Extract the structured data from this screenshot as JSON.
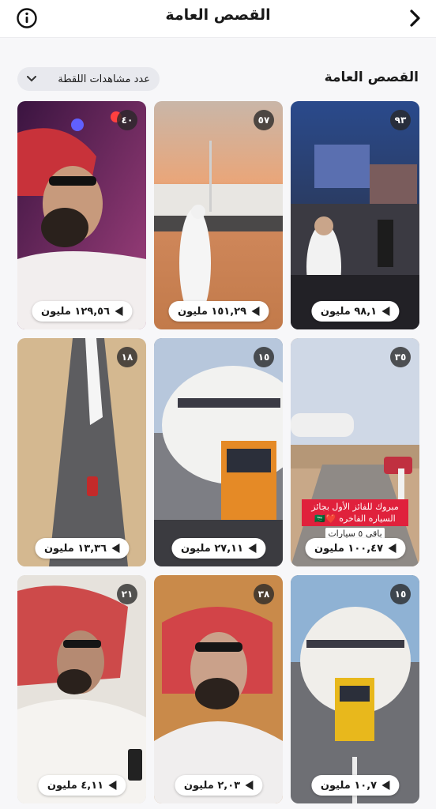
{
  "header": {
    "title": "القصص العامة"
  },
  "section": {
    "title": "القصص العامة",
    "sort_label": "عدد مشاهدات اللقطة"
  },
  "stories": [
    {
      "badge": "٩٣",
      "views": "٩٨,١ مليون",
      "scene": "arena"
    },
    {
      "badge": "٥٧",
      "views": "١٥١,٢٩ مليون",
      "scene": "desert-plane"
    },
    {
      "badge": "٤٠",
      "views": "١٢٩,٥٦ مليون",
      "scene": "portrait-smile"
    },
    {
      "badge": "٣٥",
      "views": "١٠٠,٤٧ مليون",
      "scene": "car-road",
      "overlay": "مبروك للفائز الأول بجائز السياره الفاخره ❤️🇸🇦",
      "overlay_sub": "باقي ٥ سيارات"
    },
    {
      "badge": "١٥",
      "views": "٢٧,١١ مليون",
      "scene": "plane-truck"
    },
    {
      "badge": "١٨",
      "views": "١٣,٣٦ مليون",
      "scene": "aerial-road"
    },
    {
      "badge": "١٥",
      "views": "١٠,٧ مليون",
      "scene": "plane-truck-road"
    },
    {
      "badge": "٣٨",
      "views": "٢,٠٣ مليون",
      "scene": "portrait-glasses"
    },
    {
      "badge": "٢١",
      "views": "٤,١١ مليون",
      "scene": "portrait-phone"
    }
  ],
  "colors": {
    "overlay_red": "#e0213c",
    "chip_bg": "#e8e9ee"
  },
  "icons": {
    "back": "chevron-right-icon",
    "info": "info-icon",
    "sort": "chevron-down-icon",
    "play": "play-icon"
  }
}
